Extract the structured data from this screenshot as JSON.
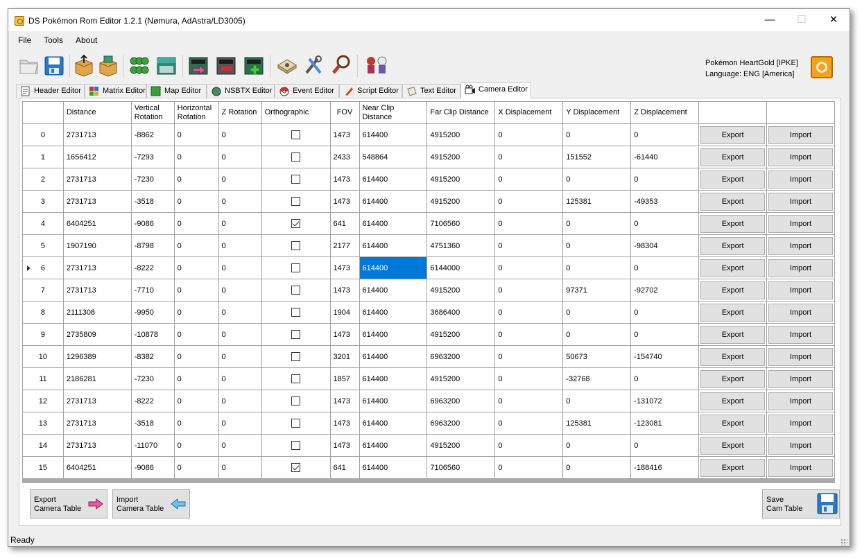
{
  "window": {
    "title": "DS Pokémon Rom Editor 1.2.1 (Nømura, AdAstra/LD3005)",
    "controls": {
      "minimize": "—",
      "maximize": "☐",
      "close": "✕"
    }
  },
  "menu": [
    "File",
    "Tools",
    "About"
  ],
  "toolbar_icons": [
    "open-folder-icon",
    "save-floppy-icon",
    "unpack-box-icon",
    "repack-box-icon",
    "clover-icon",
    "clover-icon",
    "building-icon",
    "building-export-icon",
    "building-remove-icon",
    "building-add-icon",
    "dpad-icon",
    "wrench-pencil-icon",
    "magnifier-icon",
    "trainer-sprites-icon"
  ],
  "rom": {
    "name": "Pokémon HeartGold [IPKE]",
    "language": "Language: ENG [America]"
  },
  "tabs": [
    {
      "label": "Header Editor",
      "icon": "header-icon"
    },
    {
      "label": "Matrix Editor",
      "icon": "matrix-icon"
    },
    {
      "label": "Map Editor",
      "icon": "map-icon"
    },
    {
      "label": "NSBTX Editor",
      "icon": "nsbtx-icon"
    },
    {
      "label": "Event Editor",
      "icon": "pokeball-icon"
    },
    {
      "label": "Script Editor",
      "icon": "script-icon"
    },
    {
      "label": "Text Editor",
      "icon": "scroll-icon"
    },
    {
      "label": "Camera Editor",
      "icon": "camera-icon",
      "active": true
    }
  ],
  "table": {
    "headers": [
      "Distance",
      "Vertical Rotation",
      "Horizontal Rotation",
      "Z Rotation",
      "Orthographic",
      "FOV",
      "Near Clip Distance",
      "Far Clip Distance",
      "X Displacement",
      "Y Displacement",
      "Z Displacement",
      "",
      ""
    ],
    "export_label": "Export",
    "import_label": "Import",
    "current_row": 6,
    "selected_cell": {
      "row": 6,
      "column": "near_clip"
    },
    "rows": [
      {
        "index": "0",
        "distance": "2731713",
        "vrot": "-8862",
        "hrot": "0",
        "zrot": "0",
        "ortho": false,
        "fov": "1473",
        "near": "614400",
        "far": "4915200",
        "xd": "0",
        "yd": "0",
        "zd": "0"
      },
      {
        "index": "1",
        "distance": "1656412",
        "vrot": "-7293",
        "hrot": "0",
        "zrot": "0",
        "ortho": false,
        "fov": "2433",
        "near": "548864",
        "far": "4915200",
        "xd": "0",
        "yd": "151552",
        "zd": "-61440"
      },
      {
        "index": "2",
        "distance": "2731713",
        "vrot": "-7230",
        "hrot": "0",
        "zrot": "0",
        "ortho": false,
        "fov": "1473",
        "near": "614400",
        "far": "4915200",
        "xd": "0",
        "yd": "0",
        "zd": "0"
      },
      {
        "index": "3",
        "distance": "2731713",
        "vrot": "-3518",
        "hrot": "0",
        "zrot": "0",
        "ortho": false,
        "fov": "1473",
        "near": "614400",
        "far": "4915200",
        "xd": "0",
        "yd": "125381",
        "zd": "-49353"
      },
      {
        "index": "4",
        "distance": "6404251",
        "vrot": "-9086",
        "hrot": "0",
        "zrot": "0",
        "ortho": true,
        "fov": "641",
        "near": "614400",
        "far": "7106560",
        "xd": "0",
        "yd": "0",
        "zd": "0"
      },
      {
        "index": "5",
        "distance": "1907190",
        "vrot": "-8798",
        "hrot": "0",
        "zrot": "0",
        "ortho": false,
        "fov": "2177",
        "near": "614400",
        "far": "4751360",
        "xd": "0",
        "yd": "0",
        "zd": "-98304"
      },
      {
        "index": "6",
        "distance": "2731713",
        "vrot": "-8222",
        "hrot": "0",
        "zrot": "0",
        "ortho": false,
        "fov": "1473",
        "near": "614400",
        "far": "6144000",
        "xd": "0",
        "yd": "0",
        "zd": "0"
      },
      {
        "index": "7",
        "distance": "2731713",
        "vrot": "-7710",
        "hrot": "0",
        "zrot": "0",
        "ortho": false,
        "fov": "1473",
        "near": "614400",
        "far": "4915200",
        "xd": "0",
        "yd": "97371",
        "zd": "-92702"
      },
      {
        "index": "8",
        "distance": "2111308",
        "vrot": "-9950",
        "hrot": "0",
        "zrot": "0",
        "ortho": false,
        "fov": "1904",
        "near": "614400",
        "far": "3686400",
        "xd": "0",
        "yd": "0",
        "zd": "0"
      },
      {
        "index": "9",
        "distance": "2735809",
        "vrot": "-10878",
        "hrot": "0",
        "zrot": "0",
        "ortho": false,
        "fov": "1473",
        "near": "614400",
        "far": "4915200",
        "xd": "0",
        "yd": "0",
        "zd": "0"
      },
      {
        "index": "10",
        "distance": "1296389",
        "vrot": "-8382",
        "hrot": "0",
        "zrot": "0",
        "ortho": false,
        "fov": "3201",
        "near": "614400",
        "far": "6963200",
        "xd": "0",
        "yd": "50673",
        "zd": "-154740"
      },
      {
        "index": "11",
        "distance": "2186281",
        "vrot": "-7230",
        "hrot": "0",
        "zrot": "0",
        "ortho": false,
        "fov": "1857",
        "near": "614400",
        "far": "4915200",
        "xd": "0",
        "yd": "-32768",
        "zd": "0"
      },
      {
        "index": "12",
        "distance": "2731713",
        "vrot": "-8222",
        "hrot": "0",
        "zrot": "0",
        "ortho": false,
        "fov": "1473",
        "near": "614400",
        "far": "6963200",
        "xd": "0",
        "yd": "0",
        "zd": "-131072"
      },
      {
        "index": "13",
        "distance": "2731713",
        "vrot": "-3518",
        "hrot": "0",
        "zrot": "0",
        "ortho": false,
        "fov": "1473",
        "near": "614400",
        "far": "6963200",
        "xd": "0",
        "yd": "125381",
        "zd": "-123081"
      },
      {
        "index": "14",
        "distance": "2731713",
        "vrot": "-11070",
        "hrot": "0",
        "zrot": "0",
        "ortho": false,
        "fov": "1473",
        "near": "614400",
        "far": "4915200",
        "xd": "0",
        "yd": "0",
        "zd": "0"
      },
      {
        "index": "15",
        "distance": "6404251",
        "vrot": "-9086",
        "hrot": "0",
        "zrot": "0",
        "ortho": true,
        "fov": "641",
        "near": "614400",
        "far": "7106560",
        "xd": "0",
        "yd": "0",
        "zd": "-188416"
      }
    ]
  },
  "buttons": {
    "export_table": {
      "line1": "Export",
      "line2": "Camera Table",
      "icon": "pink-arrow-right-icon"
    },
    "import_table": {
      "line1": "Import",
      "line2": "Camera Table",
      "icon": "blue-arrow-left-icon"
    },
    "save_table": {
      "line1": "Save",
      "line2": "Cam Table",
      "icon": "save-floppy-icon"
    }
  },
  "status": "Ready"
}
